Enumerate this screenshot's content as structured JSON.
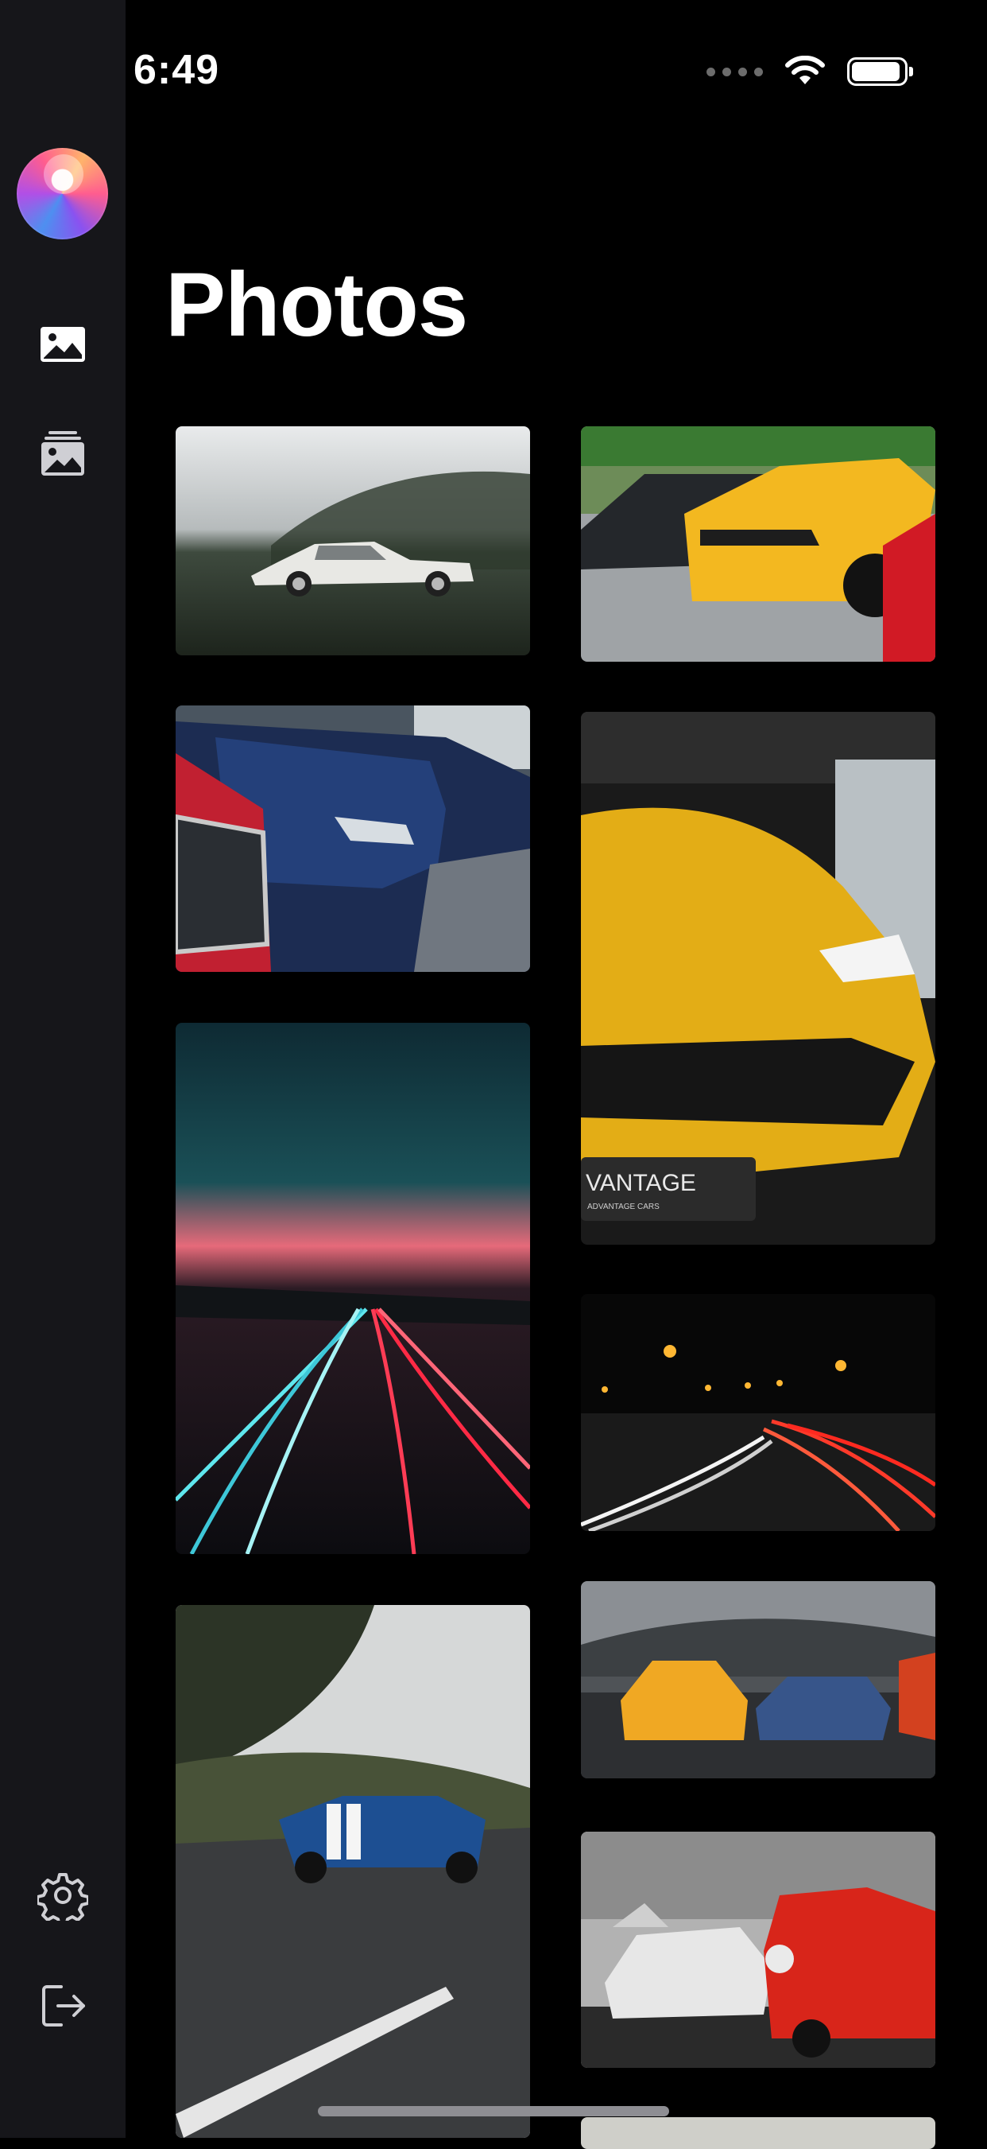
{
  "status_bar": {
    "time": "6:49",
    "battery_level": 0.85
  },
  "page": {
    "title": "Photos"
  },
  "sidebar": {
    "items": [
      {
        "name": "app-logo"
      },
      {
        "name": "photos",
        "icon": "image-icon"
      },
      {
        "name": "albums",
        "icon": "stacked-image-icon"
      },
      {
        "name": "settings",
        "icon": "gear-icon"
      },
      {
        "name": "logout",
        "icon": "logout-icon"
      }
    ]
  },
  "photos": {
    "left_column": [
      {
        "subject": "white classic car on a misty field"
      },
      {
        "subject": "row of blue cars, front headlights"
      },
      {
        "subject": "highway light trails at dusk"
      },
      {
        "subject": "blue Mustang with white stripes on a road"
      }
    ],
    "right_column": [
      {
        "subject": "black, yellow and red Mustangs parked"
      },
      {
        "subject": "yellow Lamborghini Urus front",
        "plate_text": "VANTAGE",
        "plate_subtext": "ADVANTAGE CARS"
      },
      {
        "subject": "night highway light trails with street lamps"
      },
      {
        "subject": "yellow and blue sports cars on a mountain road"
      },
      {
        "subject": "red and silver classic cars in a showroom"
      }
    ]
  }
}
